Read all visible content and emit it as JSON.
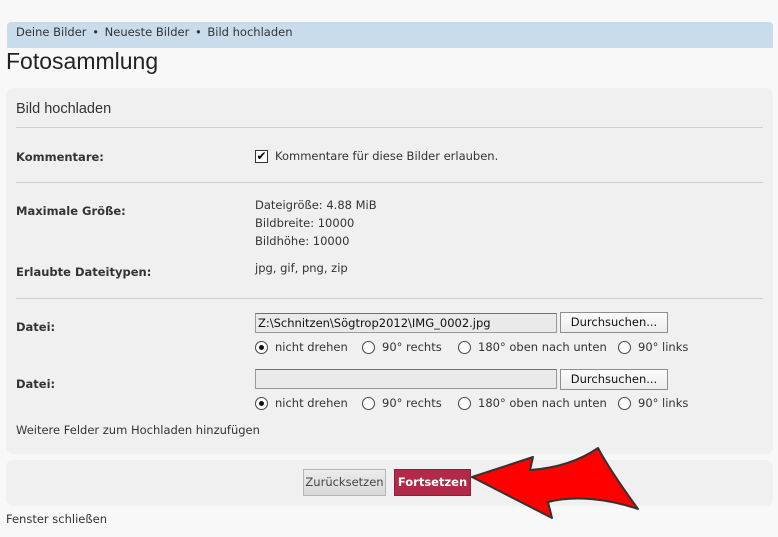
{
  "breadcrumb": {
    "items": [
      "Deine Bilder",
      "Neueste Bilder",
      "Bild hochladen"
    ],
    "separator": "•"
  },
  "page_title": "Fotosammlung",
  "panel": {
    "title": "Bild hochladen",
    "comments": {
      "label": "Kommentare:",
      "checkbox_checked": true,
      "checkbox_label": "Kommentare für diese Bilder erlauben."
    },
    "max_size": {
      "label": "Maximale Größe:",
      "lines": [
        "Dateigröße: 4.88 MiB",
        "Bildbreite: 10000",
        "Bildhöhe: 10000"
      ]
    },
    "file_types": {
      "label": "Erlaubte Dateitypen:",
      "value": "jpg, gif, png, zip"
    },
    "files": [
      {
        "label": "Datei:",
        "value": "Z:\\Schnitzen\\Sögtrop2012\\IMG_0002.jpg",
        "browse_label": "Durchsuchen...",
        "rotation_options": [
          "nicht drehen",
          "90° rechts",
          "180° oben nach unten",
          "90° links"
        ],
        "rotation_selected": "nicht drehen"
      },
      {
        "label": "Datei:",
        "value": "",
        "browse_label": "Durchsuchen...",
        "rotation_options": [
          "nicht drehen",
          "90° rechts",
          "180° oben nach unten",
          "90° links"
        ],
        "rotation_selected": "nicht drehen"
      }
    ],
    "more_fields_link": "Weitere Felder zum Hochladen hinzufügen"
  },
  "buttons": {
    "reset_label": "Zurücksetzen",
    "submit_label": "Fortsetzen"
  },
  "close_window_link": "Fenster schließen",
  "colors": {
    "breadcrumb_bg": "#c9dcec",
    "panel_bg": "#f0f0f0",
    "submit_bg": "#b12a4a",
    "arrow_fill": "#ff0000"
  }
}
